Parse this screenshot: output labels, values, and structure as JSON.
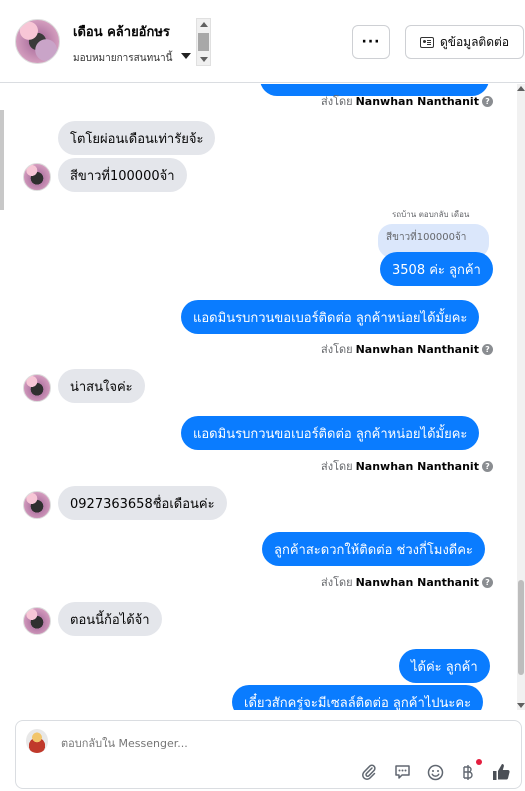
{
  "header": {
    "name": "เดือน คล้ายอักษร",
    "subtitle": "มอบหมายการสนทนานี้",
    "more_label": "···",
    "info_label": "ดูข้อมูลติดต่อ"
  },
  "messages": {
    "sent_by_prefix": "ส่งโดย",
    "sender_name": "Nanwhan Nanthanit",
    "help_glyph": "?",
    "in1": "โตโยผ่อนเดือนเท่ารัยจ้ะ",
    "in2": "สีขาวที่100000จ้า",
    "reply_hint": "รถบ้าน ตอบกลับ เดือน",
    "quoted": "สีขาวที่100000จ้า",
    "out1": "3508 ค่ะ ลูกค้า",
    "out2": "แอดมินรบกวนขอเบอร์ติดต่อ ลูกค้าหน่อยได้มั้ยคะ",
    "in3": "น่าสนใจค่ะ",
    "out3": "แอดมินรบกวนขอเบอร์ติดต่อ ลูกค้าหน่อยได้มั้ยคะ",
    "in4": "0927363658ชื่อเดือนค่ะ",
    "out4": "ลูกค้าสะดวกให้ติดต่อ ช่วงกี่โมงดีคะ",
    "in5": "ตอนนี้ก้อได้จ้า",
    "out5": "ได้ค่ะ ลูกค้า",
    "out6": "เดี๋ยวสักครู่จะมีเซลล์ติดต่อ ลูกค้าไปนะคะ"
  },
  "composer": {
    "placeholder": "ตอบกลับใน Messenger..."
  },
  "colors": {
    "outgoing": "#0a7cff",
    "incoming": "#e4e6eb",
    "notification_dot": "#e41e3f"
  }
}
